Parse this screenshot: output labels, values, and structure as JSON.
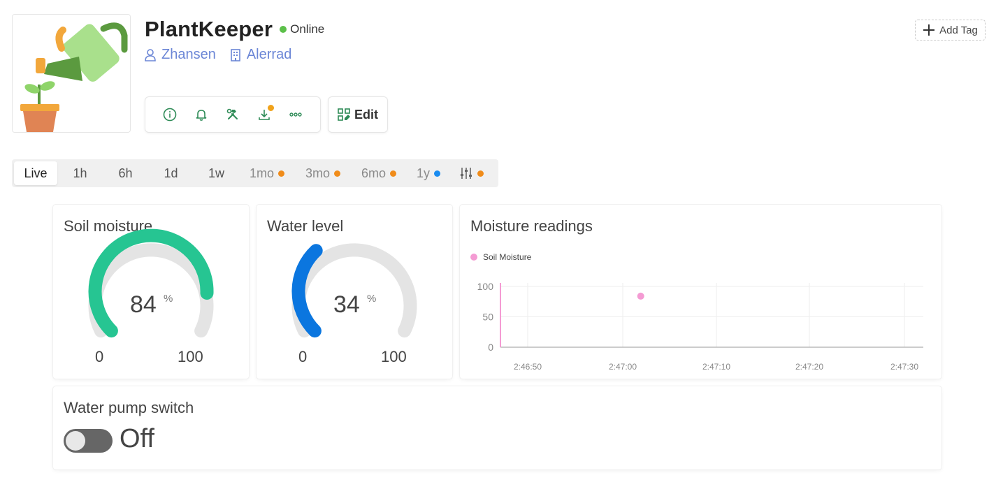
{
  "device": {
    "name": "PlantKeeper",
    "status": "Online",
    "owner": "Zhansen",
    "organization": "Alerrad"
  },
  "actions": {
    "edit_label": "Edit",
    "add_tag_label": "Add Tag"
  },
  "time_ranges": [
    {
      "label": "Live"
    },
    {
      "label": "1h"
    },
    {
      "label": "6h"
    },
    {
      "label": "1d"
    },
    {
      "label": "1w"
    },
    {
      "label": "1mo"
    },
    {
      "label": "3mo"
    },
    {
      "label": "6mo"
    },
    {
      "label": "1y"
    }
  ],
  "widgets": {
    "soil": {
      "title": "Soil moisture",
      "value": "84",
      "unit": "%",
      "min": "0",
      "max": "100",
      "color": "#26c592"
    },
    "water": {
      "title": "Water level",
      "value": "34",
      "unit": "%",
      "min": "0",
      "max": "100",
      "color": "#0b76df"
    },
    "chart": {
      "title": "Moisture readings"
    },
    "pump": {
      "title": "Water pump switch",
      "state": "Off"
    }
  },
  "chart_data": {
    "type": "scatter",
    "title": "",
    "series": [
      {
        "name": "Soil Moisture",
        "x": [
          "2:47:02"
        ],
        "y": [
          84
        ]
      }
    ],
    "x_ticks": [
      "2:46:50",
      "2:47:00",
      "2:47:10",
      "2:47:20",
      "2:47:30"
    ],
    "y_ticks": [
      "0",
      "50",
      "100"
    ],
    "ylim": [
      0,
      100
    ],
    "legend": "top-left",
    "colors": {
      "series": "#f49bd3"
    }
  }
}
